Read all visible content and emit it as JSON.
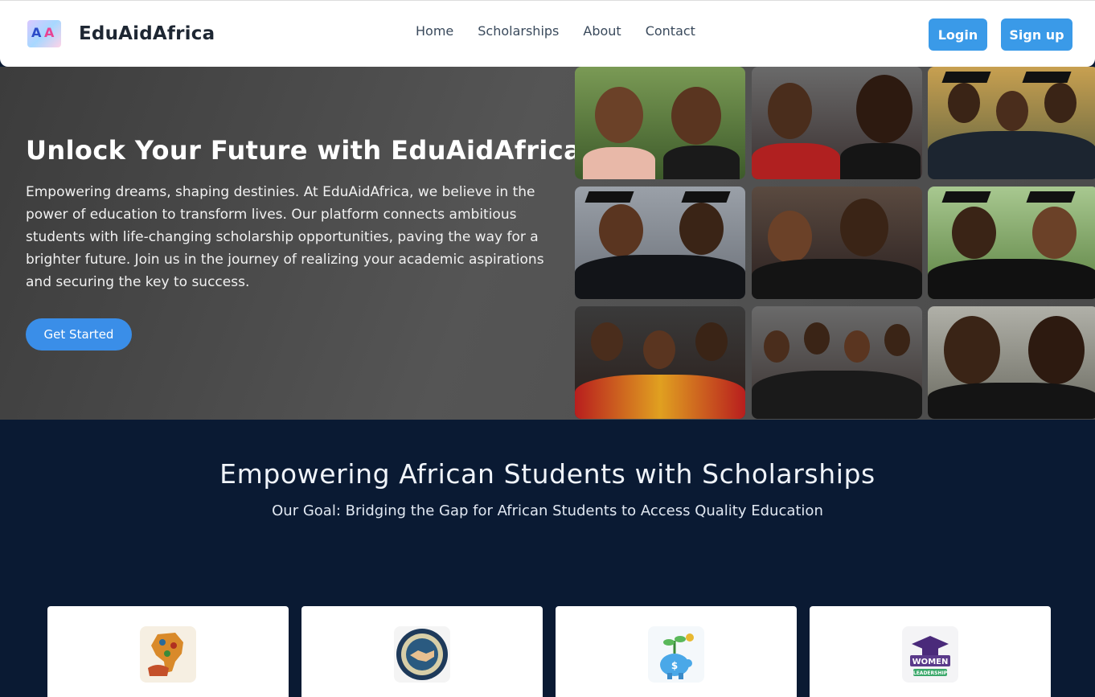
{
  "header": {
    "brand_name": "EduAidAfrica",
    "logo_letters": [
      "A",
      "A"
    ],
    "nav": [
      "Home",
      "Scholarships",
      "About",
      "Contact"
    ],
    "login_label": "Login",
    "signup_label": "Sign up"
  },
  "hero": {
    "title": "Unlock Your Future with EduAidAfrica",
    "description": "Empowering dreams, shaping destinies. At EduAidAfrica, we believe in the power of education to transform lives. Our platform connects ambitious students with life-changing scholarship opportunities, paving the way for a brighter future. Join us in the journey of realizing your academic aspirations and securing the key to success.",
    "cta_label": "Get Started"
  },
  "section": {
    "title": "Empowering African Students with Scholarships",
    "subtitle": "Our Goal: Bridging the Gap for African Students to Access Quality Education"
  },
  "cards": [
    {
      "icon": "africa-map-icon"
    },
    {
      "icon": "handshake-icon"
    },
    {
      "icon": "piggy-bank-icon"
    },
    {
      "icon": "women-in-leadership-icon",
      "icon_text": [
        "WOMEN",
        "LEADERSHIP"
      ]
    }
  ],
  "colors": {
    "accent": "#3a9ae8",
    "hero_bg": "#4a4a4a",
    "section_bg": "#0a1a33",
    "brand_text": "#1e2733"
  }
}
